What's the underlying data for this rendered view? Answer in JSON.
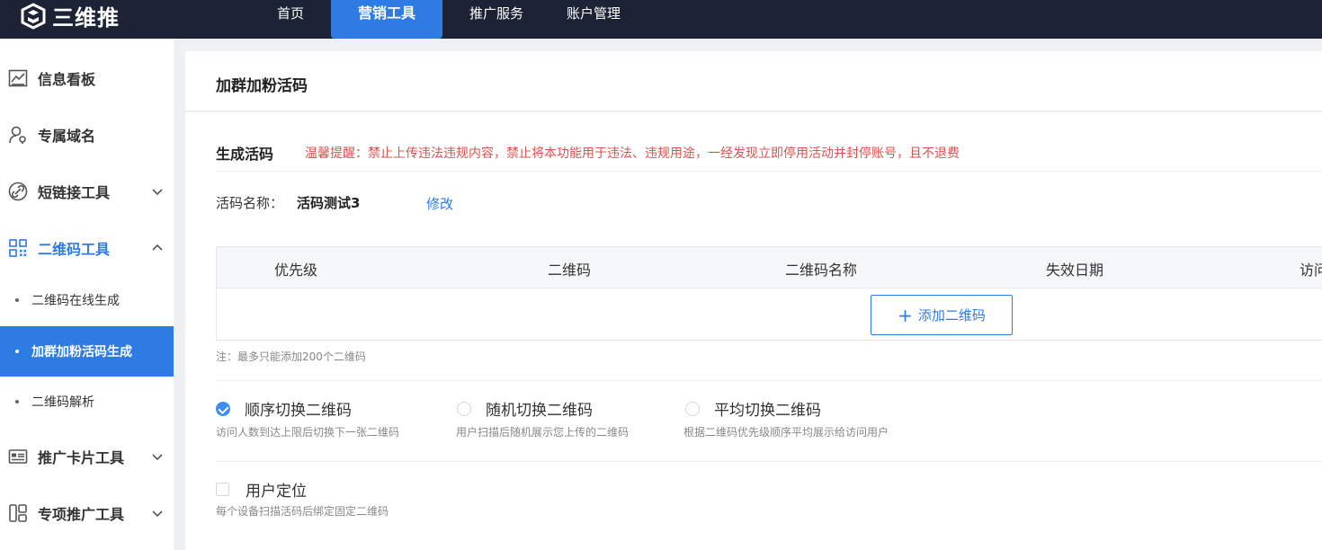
{
  "brand": {
    "name": "三维推"
  },
  "nav": {
    "items": [
      {
        "label": "首页"
      },
      {
        "label": "营销工具",
        "active": true
      },
      {
        "label": "推广服务"
      },
      {
        "label": "账户管理"
      }
    ]
  },
  "sidebar": {
    "items": [
      {
        "label": "信息看板",
        "icon": "chart-icon"
      },
      {
        "label": "专属域名",
        "icon": "user-key-icon"
      },
      {
        "label": "短链接工具",
        "icon": "link-icon",
        "chevron": "down"
      },
      {
        "label": "二维码工具",
        "icon": "qrcode-icon",
        "chevron": "up",
        "open": true
      },
      {
        "label": "推广卡片工具",
        "icon": "card-icon",
        "chevron": "down"
      },
      {
        "label": "专项推广工具",
        "icon": "layout-icon",
        "chevron": "down"
      }
    ],
    "subitems": [
      {
        "label": "二维码在线生成"
      },
      {
        "label": "加群加粉活码生成",
        "active": true
      },
      {
        "label": "二维码解析"
      }
    ]
  },
  "main": {
    "page_title": "加群加粉活码",
    "section_title": "生成活码",
    "warning": "温馨提醒：禁止上传违法违规内容，禁止将本功能用于违法、违规用途，一经发现立即停用活动并封停账号，且不退费",
    "code_name_label": "活码名称：",
    "code_name_value": "活码测试3",
    "edit_label": "修改",
    "table": {
      "columns": [
        "优先级",
        "二维码",
        "二维码名称",
        "失效日期",
        "访问"
      ]
    },
    "add_button": "添加二维码",
    "add_icon": "+",
    "note": "注：最多只能添加200个二维码",
    "switch_modes": [
      {
        "label": "顺序切换二维码",
        "desc": "访问人数到达上限后切换下一张二维码",
        "checked": true
      },
      {
        "label": "随机切换二维码",
        "desc": "用户扫描后随机展示您上传的二维码",
        "checked": false
      },
      {
        "label": "平均切换二维码",
        "desc": "根据二维码优先级顺序平均展示给访问用户",
        "checked": false
      }
    ],
    "location": {
      "label": "用户定位",
      "desc": "每个设备扫描活码后绑定固定二维码",
      "checked": false
    }
  },
  "colors": {
    "topbar": "#1d2335",
    "accent": "#2e7be3",
    "warning": "#d9534f"
  }
}
